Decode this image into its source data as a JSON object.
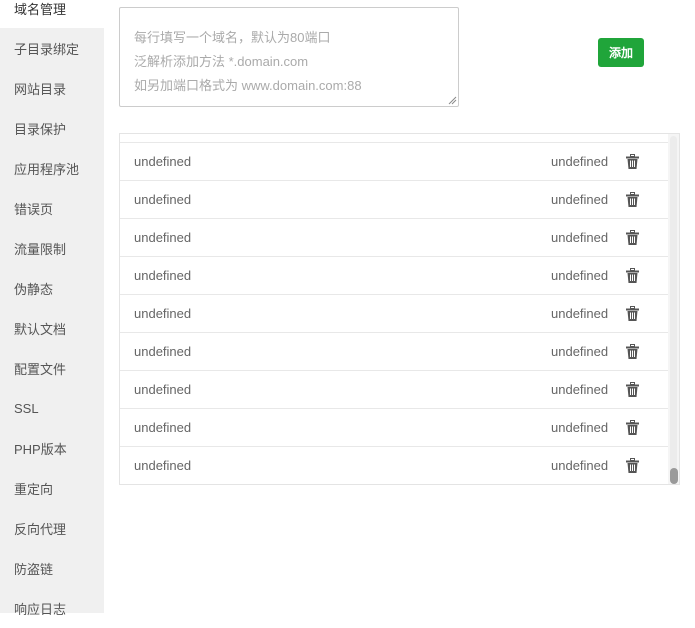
{
  "sidebar": {
    "items": [
      {
        "label": "域名管理"
      },
      {
        "label": "子目录绑定"
      },
      {
        "label": "网站目录"
      },
      {
        "label": "目录保护"
      },
      {
        "label": "应用程序池"
      },
      {
        "label": "错误页"
      },
      {
        "label": "流量限制"
      },
      {
        "label": "伪静态"
      },
      {
        "label": "默认文档"
      },
      {
        "label": "配置文件"
      },
      {
        "label": "SSL"
      },
      {
        "label": "PHP版本"
      },
      {
        "label": "重定向"
      },
      {
        "label": "反向代理"
      },
      {
        "label": "防盗链"
      },
      {
        "label": "响应日志"
      }
    ],
    "active_index": 0
  },
  "domain_input": {
    "value": "",
    "placeholder_lines": [
      "每行填写一个域名，默认为80端口",
      "泛解析添加方法 *.domain.com",
      "如另加端口格式为 www.domain.com:88"
    ]
  },
  "add_button": {
    "label": "添加"
  },
  "domain_table": {
    "rows": [
      {
        "domain": "undefined",
        "port": "undefined",
        "action_icon": "trash-icon"
      },
      {
        "domain": "undefined",
        "port": "undefined",
        "action_icon": "trash-icon"
      },
      {
        "domain": "undefined",
        "port": "undefined",
        "action_icon": "trash-icon"
      },
      {
        "domain": "undefined",
        "port": "undefined",
        "action_icon": "trash-icon"
      },
      {
        "domain": "undefined",
        "port": "undefined",
        "action_icon": "trash-icon"
      },
      {
        "domain": "undefined",
        "port": "undefined",
        "action_icon": "trash-icon"
      },
      {
        "domain": "undefined",
        "port": "undefined",
        "action_icon": "trash-icon"
      },
      {
        "domain": "undefined",
        "port": "undefined",
        "action_icon": "trash-icon"
      },
      {
        "domain": "undefined",
        "port": "undefined",
        "action_icon": "trash-icon"
      }
    ]
  },
  "colors": {
    "accent": "#20a53a",
    "sidebar_bg": "#f0f0f0",
    "active_item_bg": "#ffffff"
  }
}
